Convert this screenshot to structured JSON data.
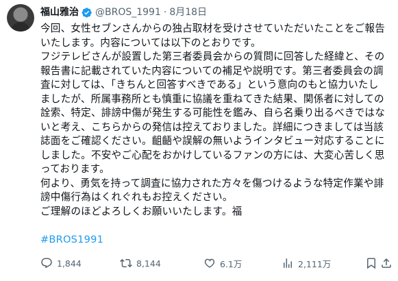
{
  "author": {
    "name": "福山雅治",
    "handle": "@BROS_1991",
    "separator": "·",
    "date": "8月18日"
  },
  "tweet": {
    "lines": [
      "今回、女性セブンさんからの独占取材を受けさせていただいたことをご報告",
      "いたします。内容については以下のとおりです。",
      "フジテレビさんが設置した第三者委員会からの質問に回答した経緯と、その",
      "報告書に記載されていた内容についての補足や説明です。第三者委員会の調",
      "査に対しては、「きちんと回答すべきである」という意向のもと協力いたし",
      "ましたが、所属事務所とも慎重に協議を重ねてきた結果、関係者に対しての",
      "詮索、特定、誹謗中傷が発生する可能性を鑑み、自ら名乗り出るべきではな",
      "いと考え、こちらからの発信は控えておりました。詳細につきましては当該",
      "誌面をご確認ください。齟齬や誤解の無いようインタビュー対応することに",
      "しました。不安やご心配をおかけしているファンの方には、大変心苦しく思",
      "っております。",
      "何より、勇気を持って調査に協力された方々を傷つけるような特定作業や誹",
      "謗中傷行為はくれぐれもお控えください。",
      "ご理解のほどよろしくお願いいたします。福"
    ],
    "hashtag": "#BROS1991"
  },
  "actions": {
    "replies": "1,844",
    "reposts": "8,144",
    "likes": "6.1万",
    "views": "2,111万"
  },
  "colors": {
    "text": "#0f1419",
    "muted": "#536471",
    "accent": "#1d9bf0"
  },
  "icons": [
    "verified-badge-icon",
    "reply-icon",
    "repost-icon",
    "like-icon",
    "views-icon",
    "bookmark-icon",
    "share-icon"
  ]
}
